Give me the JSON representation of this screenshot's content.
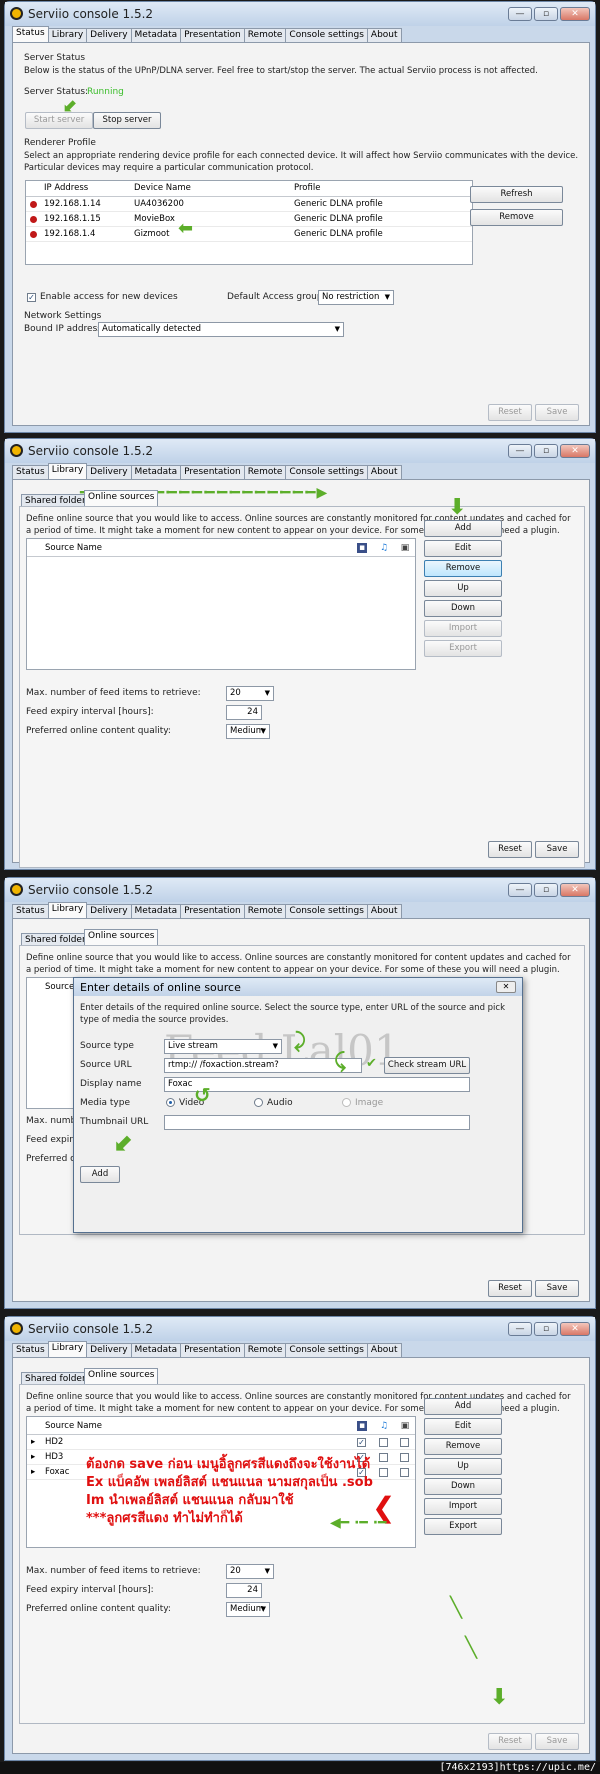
{
  "app": {
    "title": "Serviio console 1.5.2",
    "win_min": "—",
    "win_max": "▫",
    "win_close": "✕"
  },
  "tabs": [
    "Status",
    "Library",
    "Delivery",
    "Metadata",
    "Presentation",
    "Remote",
    "Console settings",
    "About"
  ],
  "status": {
    "server_status_title": "Server Status",
    "server_desc": "Below is the status of the UPnP/DLNA server. Feel free to start/stop the server. The actual Serviio process is not affected.",
    "server_status_label": "Server Status:",
    "server_status_value": "Running",
    "start_btn": "Start server",
    "stop_btn": "Stop server",
    "renderer_title": "Renderer Profile",
    "renderer_desc": "Select an appropriate rendering device profile for each connected device. It will affect how Serviio communicates with the device. Particular devices may require a particular communication protocol.",
    "columns": [
      "IP Address",
      "Device Name",
      "Profile"
    ],
    "rows": [
      {
        "ip": "192.168.1.14",
        "name": "UA4036200",
        "profile": "Generic DLNA profile"
      },
      {
        "ip": "192.168.1.15",
        "name": "MovieBox",
        "profile": "Generic DLNA profile"
      },
      {
        "ip": "192.168.1.4",
        "name": "Gizmoot",
        "profile": "Generic DLNA profile"
      }
    ],
    "refresh_btn": "Refresh",
    "remove_btn": "Remove",
    "enable_access": "Enable access for new devices",
    "default_group_label": "Default Access group:",
    "default_group_value": "No restriction",
    "network_title": "Network Settings",
    "bound_ip_label": "Bound IP address:",
    "bound_ip_value": "Automatically detected",
    "reset_btn": "Reset",
    "save_btn": "Save"
  },
  "library": {
    "subtab_shared": "Shared folders",
    "subtab_online": "Online sources",
    "desc": "Define online source that you would like to access. Online sources are constantly monitored for content updates and cached for a period of time. It might take a moment for new content to appear on your device. For some of these you will need a plugin.",
    "source_name_col": "Source Name",
    "icon_video": "▪",
    "icon_audio": "♫",
    "icon_image": "▣",
    "buttons": {
      "add": "Add",
      "edit": "Edit",
      "remove": "Remove",
      "up": "Up",
      "down": "Down",
      "import": "Import",
      "export": "Export"
    },
    "max_items_label": "Max. number of feed items to retrieve:",
    "max_items_value": "20",
    "expiry_label": "Feed expiry interval [hours]:",
    "expiry_value": "24",
    "quality_label": "Preferred online content quality:",
    "quality_value": "Medium",
    "reset_btn": "Reset",
    "save_btn": "Save",
    "sources": [
      {
        "name": "HD2",
        "video": "✓",
        "audio": "",
        "image": ""
      },
      {
        "name": "HD3",
        "video": "✓",
        "audio": "",
        "image": ""
      },
      {
        "name": "Foxac",
        "video": "✓",
        "audio": "",
        "image": ""
      }
    ]
  },
  "dialog": {
    "title": "Enter details of online source",
    "close": "✕",
    "desc": "Enter details of the required online source. Select the source type, enter URL of the source and pick type of media the source provides.",
    "source_type_label": "Source type",
    "source_type_value": "Live stream",
    "source_url_label": "Source URL",
    "source_url_value": "rtmp://                   /foxaction.stream?",
    "check_btn": "Check stream URL",
    "display_name_label": "Display name",
    "display_name_value": "Foxac",
    "media_type_label": "Media type",
    "media_video": "Video",
    "media_audio": "Audio",
    "media_image": "Image",
    "thumb_label": "Thumbnail URL",
    "add_btn": "Add",
    "watermark": "Feed Lal01"
  },
  "dialog_bg": {
    "source_name": "Source N",
    "max_short": "Max. number of",
    "expiry_short": "Feed expiry in",
    "pref_short": "Preferred onlin",
    "btn_ve": "ve",
    "btn_n": "n",
    "btn_t1": "t",
    "btn_t2": "t"
  },
  "notes": {
    "line1": "ต้องกด save ก่อน เมนูอิ้ลูกศรสีแดงถึงจะใช้งานได้",
    "line2": "Ex แบ็คอัพ เพลย์ลิสต์ แชนแนล นามสกุลเป็น .sob",
    "line3": "Im นำเพลย์ลิสต์ แชนแนล กลับมาใช้",
    "line4": "***ลูกศรสีแดง ทำไม่ทำก็ได้"
  },
  "footer": "[746x2193]https://upic.me/",
  "colors": {
    "running": "#3cbd2c",
    "annot_green": "#5cae2a",
    "annot_red": "#e01010"
  }
}
